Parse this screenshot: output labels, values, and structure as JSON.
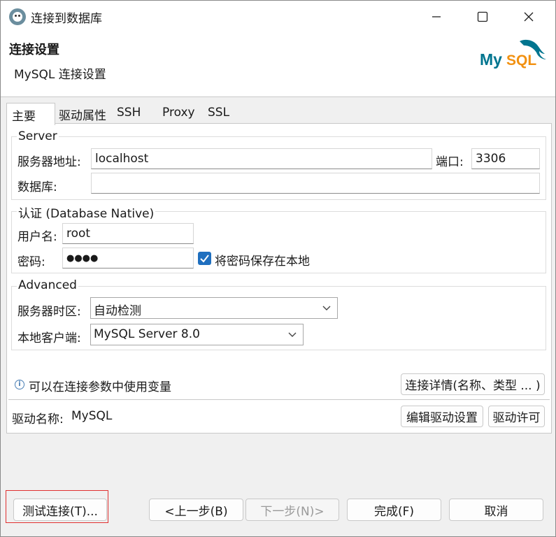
{
  "window": {
    "title": "连接到数据库",
    "controls": {
      "minimize": "minimize-icon",
      "maximize": "maximize-icon",
      "close": "close-icon"
    }
  },
  "header": {
    "title": "连接设置",
    "subtitle": "MySQL 连接设置",
    "logo_text": "MySQL"
  },
  "tabs": [
    {
      "label": "主要",
      "active": true
    },
    {
      "label": "驱动属性",
      "active": false
    },
    {
      "label": "SSH",
      "active": false
    },
    {
      "label": "Proxy",
      "active": false
    },
    {
      "label": "SSL",
      "active": false
    }
  ],
  "server": {
    "group_label": "Server",
    "host_label": "服务器地址:",
    "host_value": "localhost",
    "port_label": "端口:",
    "port_value": "3306",
    "database_label": "数据库:",
    "database_value": ""
  },
  "auth": {
    "group_label": "认证 (Database Native)",
    "username_label": "用户名:",
    "username_value": "root",
    "password_label": "密码:",
    "password_value": "●●●●",
    "save_password_label": "将密码保存在本地",
    "save_password_checked": true
  },
  "advanced": {
    "group_label": "Advanced",
    "timezone_label": "服务器时区:",
    "timezone_value": "自动检测",
    "client_label": "本地客户端:",
    "client_value": "MySQL Server 8.0"
  },
  "info": {
    "variables_hint": "可以在连接参数中使用变量",
    "details_button": "连接详情(名称、类型 ... )"
  },
  "driver": {
    "name_label": "驱动名称:",
    "name_value": "MySQL",
    "edit_button": "编辑驱动设置",
    "license_button": "驱动许可"
  },
  "footer": {
    "test_button": "测试连接(T)...",
    "back_button": "<上一步(B)",
    "next_button": "下一步(N)>",
    "finish_button": "完成(F)",
    "cancel_button": "取消"
  },
  "colors": {
    "accent": "#1f6fbf",
    "mysql_blue": "#00758f",
    "mysql_orange": "#f29111",
    "highlight": "#e03030"
  }
}
